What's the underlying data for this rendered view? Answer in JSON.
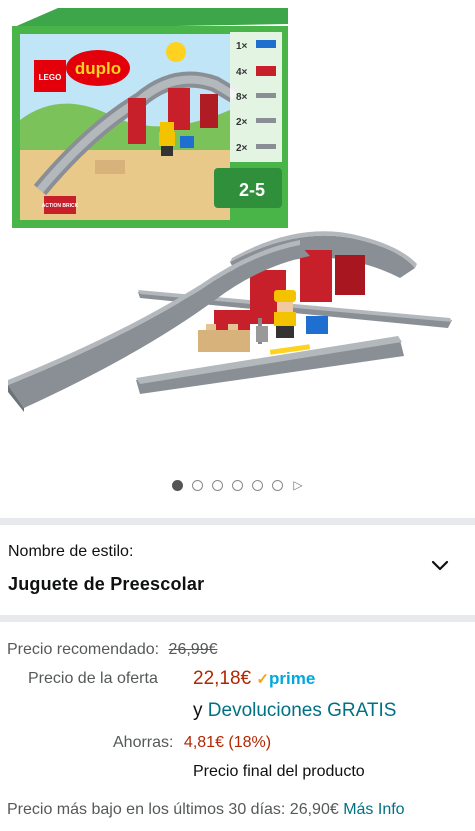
{
  "gallery": {
    "box": {
      "brand_lego": "LEGO",
      "brand_duplo": "duplo",
      "age_range": "2-5",
      "badge": "ACTION BRICK",
      "contents": [
        "1×",
        "4×",
        "8×",
        "2×",
        "2×"
      ]
    },
    "dots": {
      "count": 6,
      "active_index": 0
    }
  },
  "style_selector": {
    "label": "Nombre de estilo:",
    "value": "Juguete de Preescolar"
  },
  "pricing": {
    "recommended_label": "Precio recomendado:",
    "recommended_price": "26,99€",
    "offer_label": "Precio de la oferta",
    "offer_price": "22,18€",
    "prime_check": "✓",
    "prime_text": "prime",
    "returns_prefix": "y",
    "returns_link": "Devoluciones GRATIS",
    "savings_label": "Ahorras:",
    "savings_value": "4,81€ (18%)",
    "final_price_note": "Precio final del producto",
    "lowest_price_text": "Precio más bajo en los últimos 30 días: 26,90€",
    "more_info_link": "Más Info"
  },
  "colors": {
    "price_red": "#b12704",
    "link_teal": "#007185",
    "prime_blue": "#00a8e1",
    "separator": "#e7e9ec"
  }
}
